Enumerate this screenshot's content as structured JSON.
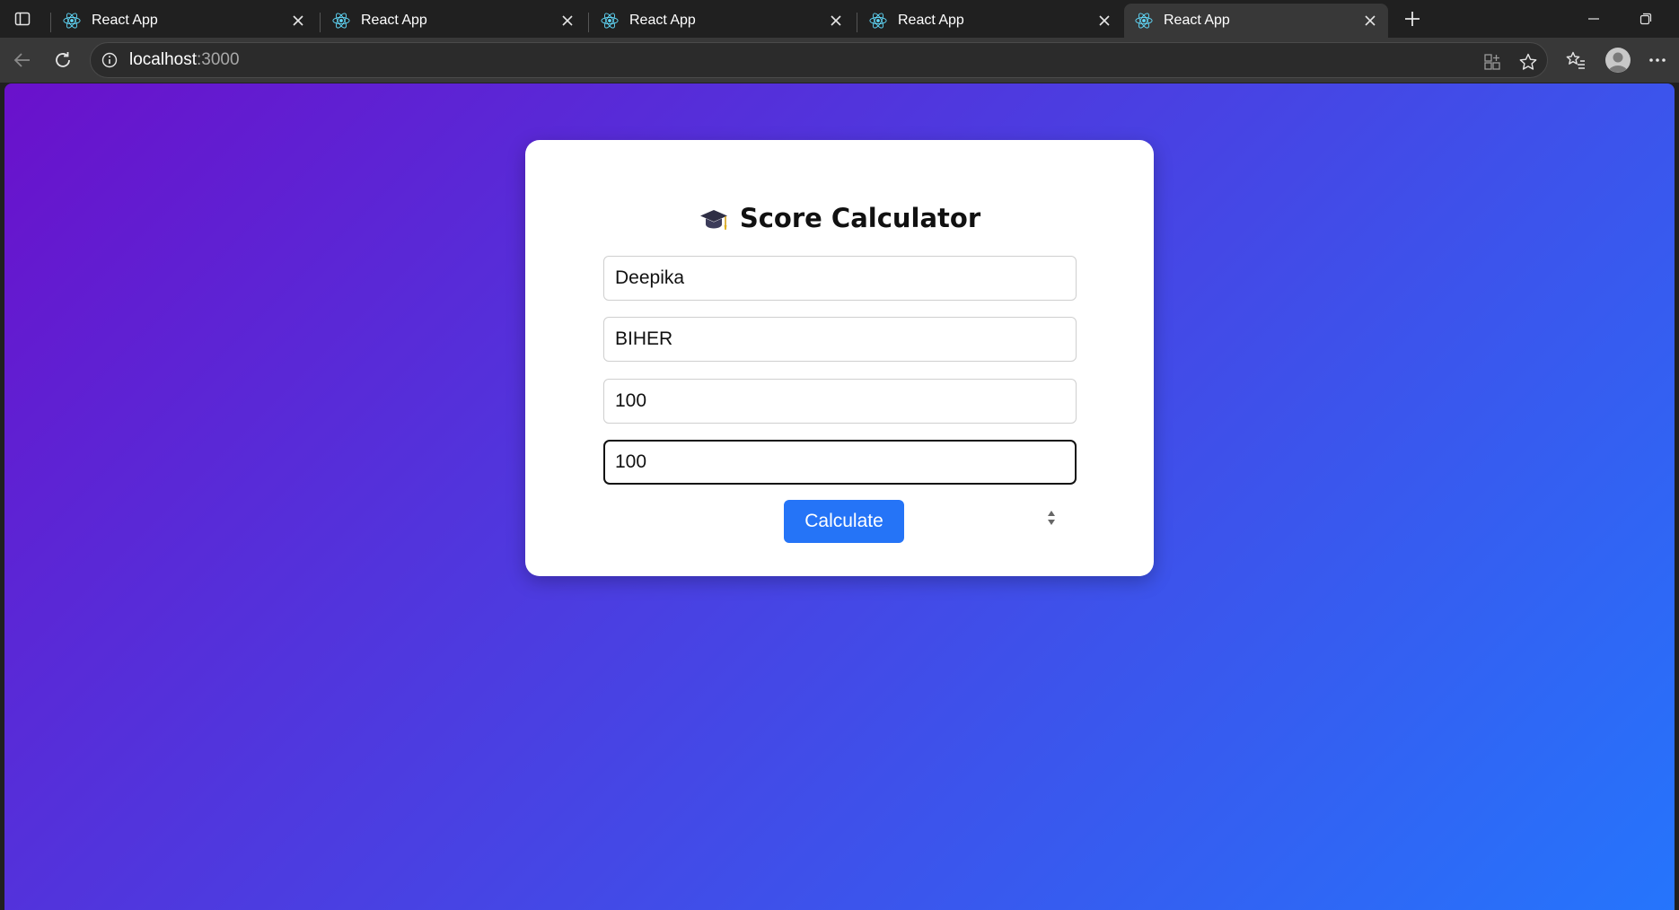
{
  "browser": {
    "tabs": [
      {
        "title": "React App",
        "active": false
      },
      {
        "title": "React App",
        "active": false
      },
      {
        "title": "React App",
        "active": false
      },
      {
        "title": "React App",
        "active": false
      },
      {
        "title": "React App",
        "active": true
      }
    ],
    "address_bar": {
      "host": "localhost",
      "port": ":3000"
    }
  },
  "page": {
    "title": "Score Calculator",
    "title_icon": "graduation-cap-icon",
    "fields": {
      "name_value": "Deepika",
      "college_value": "BIHER",
      "score1_value": "100",
      "score2_value": "100"
    },
    "calculate_label": "Calculate"
  },
  "colors": {
    "gradient_start": "#6a11cb",
    "gradient_end": "#2575fc",
    "button": "#2574f7",
    "browser_chrome": "#202020"
  }
}
